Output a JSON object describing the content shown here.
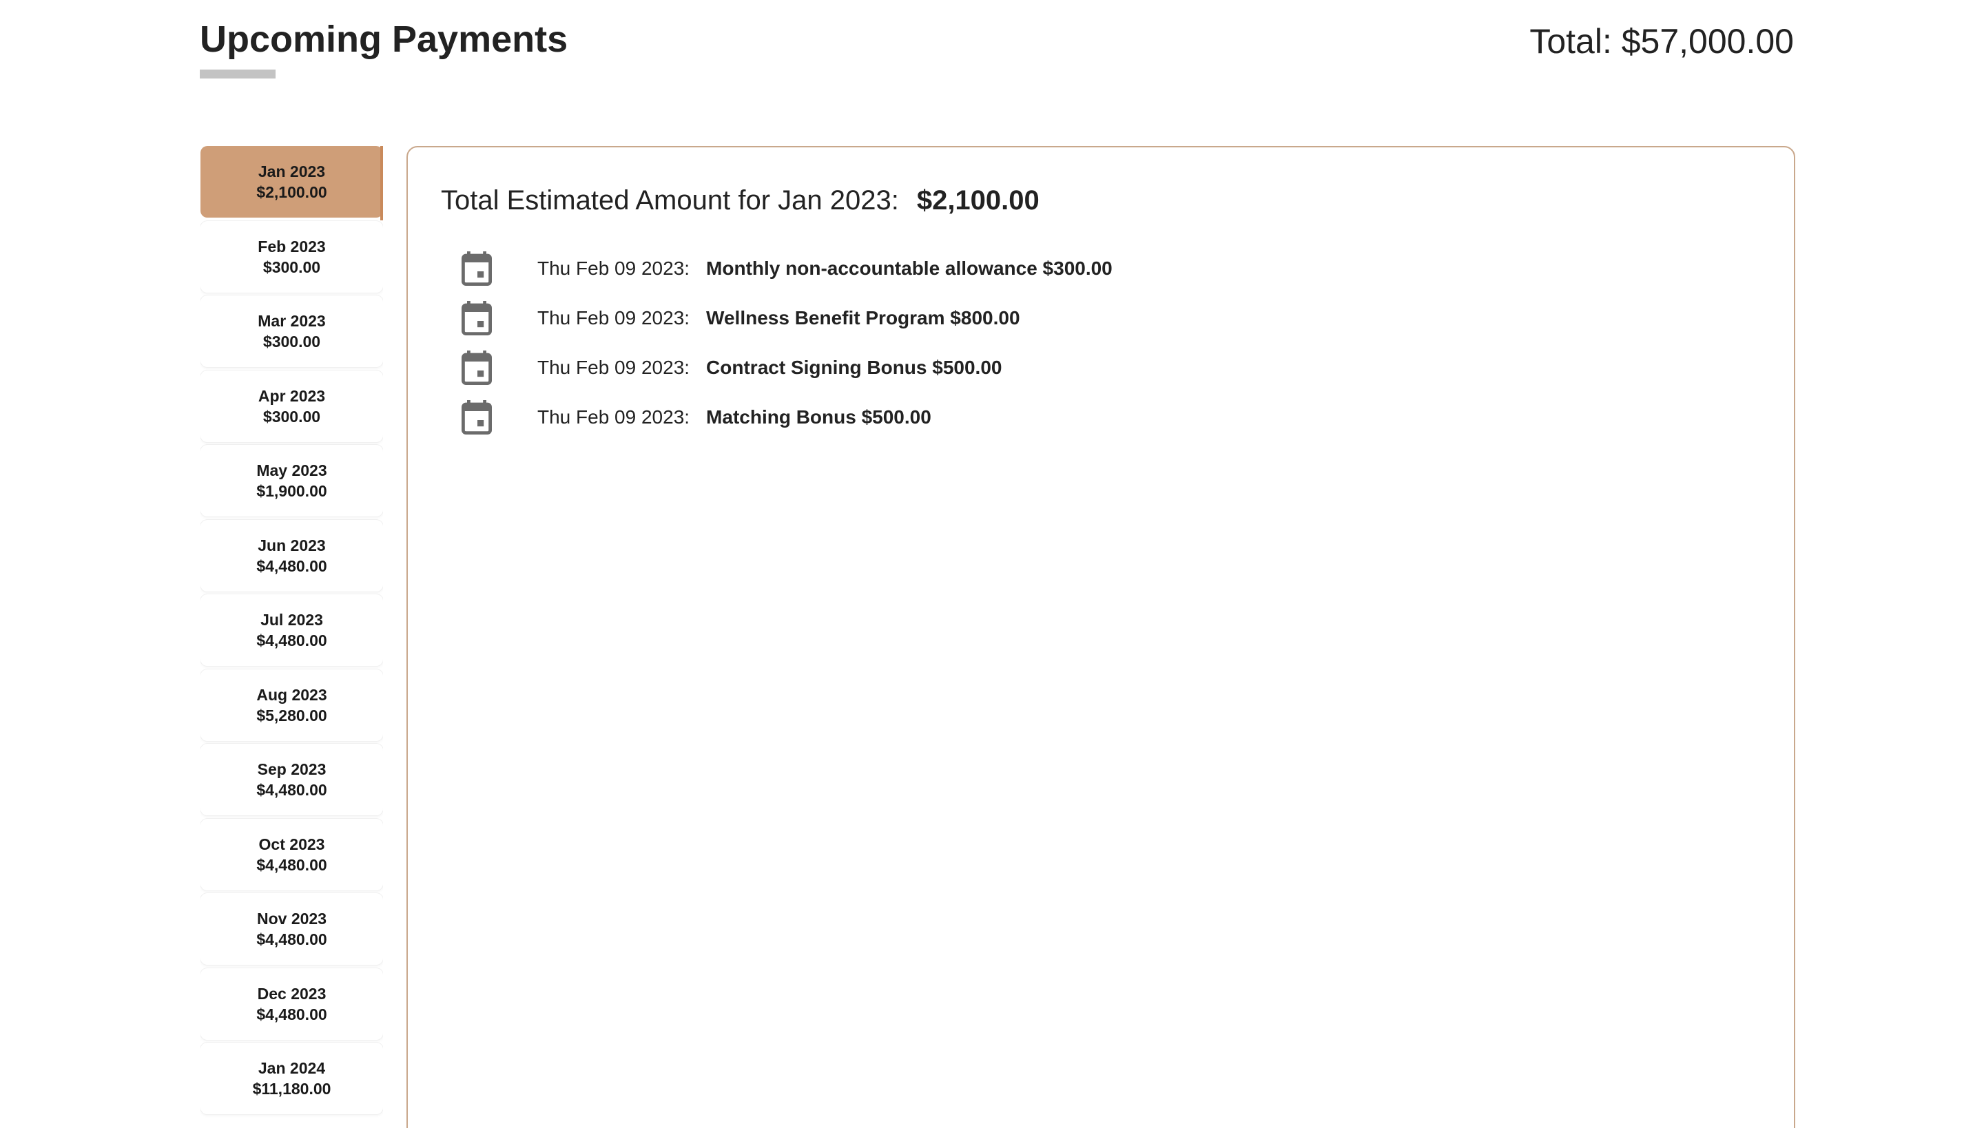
{
  "header": {
    "title": "Upcoming Payments",
    "total_label": "Total: $57,000.00"
  },
  "sidebar": {
    "selected_index": 0,
    "items": [
      {
        "label": "Jan 2023",
        "amount": "$2,100.00"
      },
      {
        "label": "Feb 2023",
        "amount": "$300.00"
      },
      {
        "label": "Mar 2023",
        "amount": "$300.00"
      },
      {
        "label": "Apr 2023",
        "amount": "$300.00"
      },
      {
        "label": "May 2023",
        "amount": "$1,900.00"
      },
      {
        "label": "Jun 2023",
        "amount": "$4,480.00"
      },
      {
        "label": "Jul 2023",
        "amount": "$4,480.00"
      },
      {
        "label": "Aug 2023",
        "amount": "$5,280.00"
      },
      {
        "label": "Sep 2023",
        "amount": "$4,480.00"
      },
      {
        "label": "Oct 2023",
        "amount": "$4,480.00"
      },
      {
        "label": "Nov 2023",
        "amount": "$4,480.00"
      },
      {
        "label": "Dec 2023",
        "amount": "$4,480.00"
      },
      {
        "label": "Jan 2024",
        "amount": "$11,180.00"
      }
    ]
  },
  "detail": {
    "heading": "Total Estimated Amount for Jan 2023:",
    "amount": "$2,100.00",
    "payments": [
      {
        "date": "Thu Feb 09 2023:",
        "description": "Monthly non-accountable allowance $300.00",
        "icon": "calendar-icon"
      },
      {
        "date": "Thu Feb 09 2023:",
        "description": "Wellness Benefit Program $800.00",
        "icon": "calendar-icon"
      },
      {
        "date": "Thu Feb 09 2023:",
        "description": "Contract Signing Bonus $500.00",
        "icon": "calendar-icon"
      },
      {
        "date": "Thu Feb 09 2023:",
        "description": "Matching Bonus $500.00",
        "icon": "calendar-icon"
      }
    ]
  },
  "colors": {
    "accent": "#cf9e78",
    "accent_border": "#c98a5b",
    "panel_border": "#c9a88c",
    "underline": "#c3c3c3",
    "icon": "#6b6b6b"
  }
}
